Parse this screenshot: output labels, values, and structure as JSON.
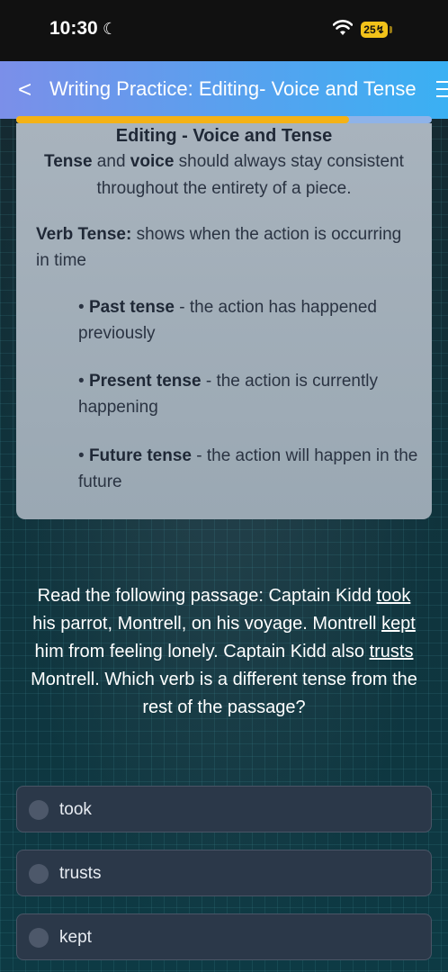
{
  "status": {
    "time": "10:30",
    "battery": "25"
  },
  "header": {
    "back_glyph": "<",
    "title": "Writing Practice: Editing- Voice and Tense"
  },
  "progress": {
    "fraction": 0.8
  },
  "lesson": {
    "title": "Editing - Voice and Tense",
    "intro": {
      "w1": "Tense",
      "t1": " and ",
      "w2": "voice",
      "t2": " should always stay consistent throughout the entirety of a piece."
    },
    "verb_tense": {
      "label": "Verb Tense:",
      "text": " shows when the action is occurring in time"
    },
    "bullets": [
      {
        "dot": "•",
        "term": "Past tense",
        "text": " - the action has happened previously"
      },
      {
        "dot": "•",
        "term": "Present tense",
        "text": " - the action is currently happening"
      },
      {
        "dot": "•",
        "term": "Future tense",
        "text": " - the action will happen in the future"
      }
    ]
  },
  "question": {
    "p1": "Read the following passage: Captain Kidd ",
    "u1": "took",
    "p2": " his parrot, Montrell, on his voyage. Montrell ",
    "u2": "kept",
    "p3": " him from feeling lonely. Captain Kidd also ",
    "u3": "trusts",
    "p4": " Montrell. Which verb is a different tense from the rest of the passage?"
  },
  "options": [
    {
      "label": "took"
    },
    {
      "label": "trusts"
    },
    {
      "label": "kept"
    }
  ],
  "colors": {
    "accent_progress": "#f4b216",
    "header_start": "#7b8fe9",
    "header_end": "#3ab0f3"
  }
}
